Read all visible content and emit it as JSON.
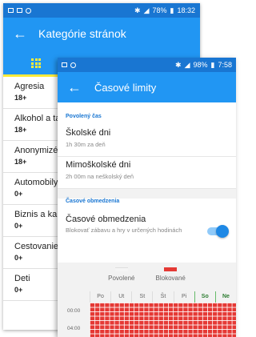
{
  "colors": {
    "primary": "#2196f3",
    "status_bar": "#1976d2",
    "active_tab": "#ffeb3b",
    "blocked": "#e53935",
    "weekend": "#2e7d32"
  },
  "back_screen": {
    "status_bar": {
      "battery": "78%",
      "time": "18:32"
    },
    "app_bar": {
      "title": "Kategórie stránok"
    },
    "tabs": [
      {
        "icon": "grid-icon",
        "active": true
      },
      {
        "icon": "send-icon",
        "active": false
      },
      {
        "icon": "document-icon",
        "active": false
      }
    ],
    "categories": [
      {
        "name": "Agresia",
        "age": "18+"
      },
      {
        "name": "Alkohol a tab",
        "age": "18+"
      },
      {
        "name": "Anonymizér",
        "age": "18+"
      },
      {
        "name": "Automobily",
        "age": "0+"
      },
      {
        "name": "Biznis a kari",
        "age": "0+"
      },
      {
        "name": "Cestovanie",
        "age": "0+"
      },
      {
        "name": "Deti",
        "age": "0+"
      }
    ]
  },
  "front_screen": {
    "status_bar": {
      "battery": "98%",
      "time": "7:58"
    },
    "app_bar": {
      "title": "Časové limity"
    },
    "allowed_section": {
      "header": "Povolený čas",
      "items": [
        {
          "title": "Školské dni",
          "subtitle": "1h 30m za deň"
        },
        {
          "title": "Mimoškolské dni",
          "subtitle": "2h 00m na neškolský deň"
        }
      ]
    },
    "restriction_section": {
      "header": "Časové obmedzenia",
      "toggle": {
        "title": "Časové obmedzenia",
        "description": "Blokovať zábavu a hry v určených hodinách",
        "enabled": true
      }
    },
    "schedule": {
      "legend": {
        "allowed": "Povolené",
        "blocked": "Blokované"
      },
      "days": [
        "Po",
        "Ut",
        "St",
        "Št",
        "Pi",
        "So",
        "Ne"
      ],
      "weekend_days": [
        "So",
        "Ne"
      ],
      "hours": [
        "00:00",
        "04:00"
      ],
      "visible_cells_state": "blocked"
    }
  }
}
